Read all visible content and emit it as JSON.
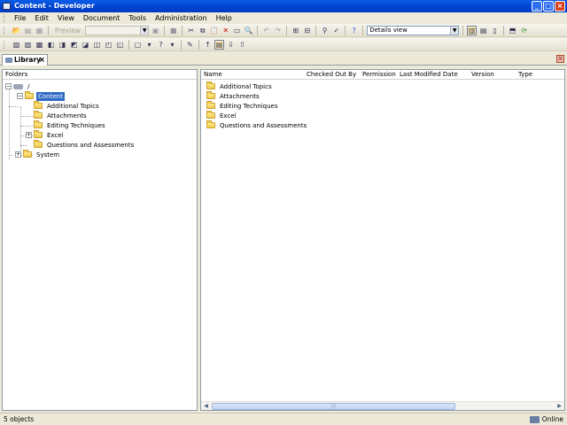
{
  "window": {
    "title": "Content - Developer"
  },
  "menu": [
    "File",
    "Edit",
    "View",
    "Document",
    "Tools",
    "Administration",
    "Help"
  ],
  "toolbar": {
    "preview_label": "Preview",
    "view_select": "Details view"
  },
  "tab": {
    "label": "Library"
  },
  "folders_header": "Folders",
  "tree": {
    "root": "/",
    "content": "Content",
    "children": [
      "Additional Topics",
      "Attachments",
      "Editing Techniques",
      "Excel",
      "Questions and Assessments"
    ],
    "system": "System"
  },
  "columns": [
    "Name",
    "Checked Out By",
    "Permission",
    "Last Modified Date",
    "Version",
    "Type"
  ],
  "items": [
    "Additional Topics",
    "Attachments",
    "Editing Techniques",
    "Excel",
    "Questions and Assessments"
  ],
  "status": {
    "count": "5 objects",
    "mode": "Online"
  },
  "colors": {
    "selection": "#316ac5",
    "titlebar": "#0a5ee6"
  }
}
